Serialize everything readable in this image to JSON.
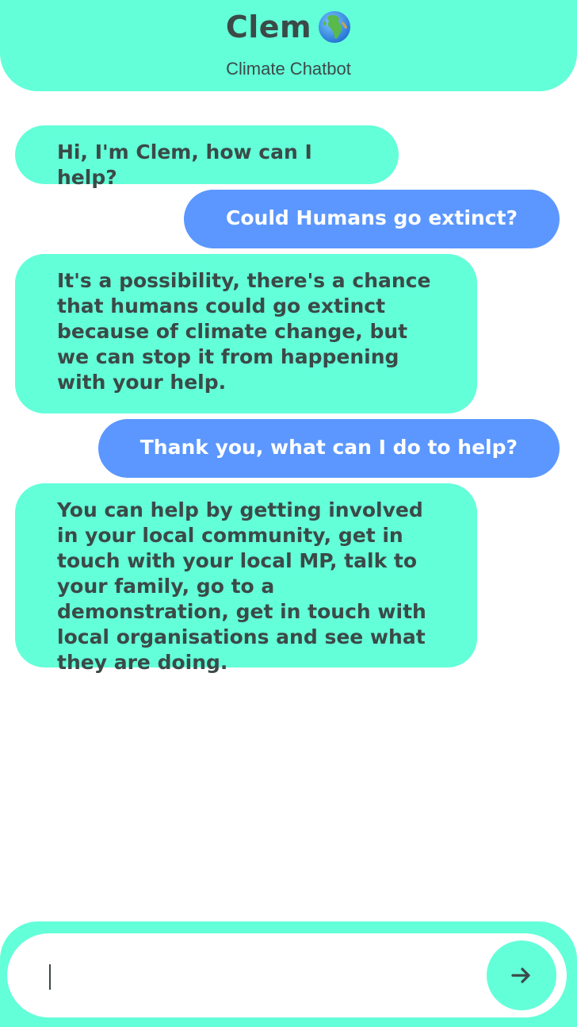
{
  "header": {
    "title": "Clem",
    "subtitle": "Climate Chatbot",
    "icon": "globe-icon"
  },
  "conversation": {
    "messages": [
      {
        "sender": "bot",
        "text": "Hi, I'm Clem, how can I help?"
      },
      {
        "sender": "user",
        "text": "Could Humans go extinct?"
      },
      {
        "sender": "bot",
        "text": "It's a possibility, there's a chance that humans could go extinct because of climate change, but we can stop it from happening with your help."
      },
      {
        "sender": "user",
        "text": "Thank you, what can I do to help?"
      },
      {
        "sender": "bot",
        "text": "You can help by getting involved in your local community, get in touch with your local MP, talk to your family, go to a demonstration, get in touch with local organisations and see what they are doing."
      }
    ]
  },
  "composer": {
    "value": "",
    "send_icon": "arrow-right-icon"
  },
  "colors": {
    "accent": "#63ffd9",
    "user_bubble": "#5b97ff",
    "text_dark": "#3b4a47",
    "text_light": "#ffffff"
  }
}
